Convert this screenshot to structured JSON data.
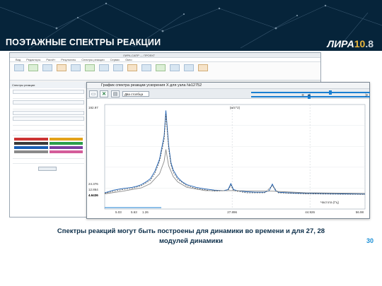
{
  "slide": {
    "title": "ПОЭТАЖНЫЕ СПЕКТРЫ РЕАКЦИИ",
    "logo": {
      "name": "ЛИРА",
      "version_major": "10",
      "version_minor": ".8"
    },
    "caption": "Спектры реакций могут быть построены для динамики во времени и для 27, 28 модулей динамики",
    "page_number": "30",
    "colors": {
      "header": "#06243a",
      "caption": "#0d2f4a",
      "page_number": "#1a8fd6",
      "plot_primary": "#1a5fb4"
    }
  },
  "app": {
    "window_title": "ЛИРА-САПР — ПРОЕКТ",
    "menu": [
      "Вид",
      "Редакторы",
      "Расчёт",
      "Результаты",
      "Спектры реакции",
      "Сервис",
      "Окно"
    ],
    "left_panel": {
      "title": "Спектры реакции"
    }
  },
  "dialog": {
    "title": "График спектра реакции ускорения X для узла №12752",
    "toolbar": {
      "buttons": [
        {
          "name": "open-icon",
          "glyph": "▭"
        },
        {
          "name": "excel-icon",
          "glyph": "✕"
        },
        {
          "name": "table-icon",
          "glyph": "▤"
        }
      ],
      "select_value": "Два столбца",
      "plus_glyph": "+",
      "left_arrow_glyph": "<",
      "right_arrow_glyph": ">"
    }
  },
  "chart_data": {
    "type": "line",
    "title": "(м/с^2)",
    "y_readout_top": "192.97",
    "y_readouts": [
      "24.376",
      "12.864",
      "4.6436"
    ],
    "x_readouts": [
      "5.03",
      "5.63",
      "1.26"
    ],
    "x_ticks": [
      {
        "value": 27.896,
        "label": "27.896"
      },
      {
        "value": 44.926,
        "label": "44.926"
      },
      {
        "value": 56.98,
        "label": "56.98"
      }
    ],
    "xlabel": "Частота (Гц)",
    "ylabel": "",
    "xlim": [
      0,
      56.98
    ],
    "ylim": [
      0,
      192.97
    ],
    "series": [
      {
        "color": "#1a5fb4",
        "style": "solid",
        "x": [
          0,
          2,
          4,
          6,
          7,
          8,
          9,
          10,
          11,
          12,
          13,
          13.4,
          14,
          14.5,
          15,
          16,
          17,
          18,
          20,
          22,
          24,
          26,
          27,
          27.6,
          28.2,
          29,
          31,
          33,
          35,
          36,
          36.7,
          37.4,
          38,
          40,
          44,
          48,
          52,
          56.98
        ],
        "y": [
          30,
          35,
          38,
          40,
          42,
          45,
          50,
          56,
          70,
          92,
          135,
          182,
          118,
          86,
          72,
          58,
          50,
          45,
          40,
          37,
          35,
          34,
          36,
          47,
          36,
          34,
          32,
          31,
          31,
          34,
          46,
          34,
          31,
          30,
          29,
          28.5,
          28,
          27.5
        ]
      },
      {
        "color": "#3a3a3a",
        "style": "dashed",
        "x": [
          0,
          2,
          4,
          6,
          8,
          10,
          11,
          12,
          13,
          13.4,
          14,
          14.5,
          15,
          16,
          18,
          20,
          24,
          27,
          27.6,
          28.2,
          31,
          35,
          36.7,
          38,
          44,
          50,
          56.98
        ],
        "y": [
          29,
          33,
          36,
          38,
          43,
          53,
          66,
          88,
          128,
          175,
          112,
          82,
          68,
          55,
          43,
          38,
          33,
          34,
          44,
          34,
          30,
          30,
          43,
          30,
          28,
          27.5,
          27
        ]
      },
      {
        "color": "#8a8a8a",
        "style": "solid",
        "x": [
          0,
          4,
          8,
          10,
          12,
          13,
          13.4,
          14,
          15,
          16,
          18,
          22,
          27.6,
          36.7,
          44,
          56.98
        ],
        "y": [
          28,
          33,
          39,
          47,
          65,
          88,
          110,
          80,
          60,
          50,
          40,
          34,
          34,
          33,
          30,
          29
        ]
      }
    ]
  }
}
